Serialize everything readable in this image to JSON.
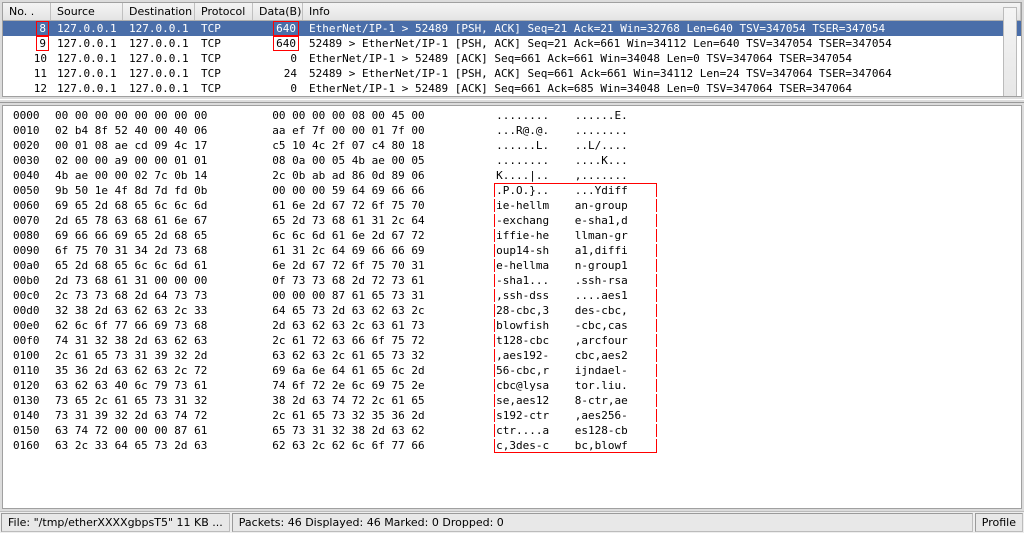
{
  "columns": {
    "no": "No. .",
    "src": "Source",
    "dst": "Destination",
    "proto": "Protocol",
    "data": "Data(B)",
    "info": "Info"
  },
  "packets": [
    {
      "no": "8",
      "no_red": true,
      "src": "127.0.0.1",
      "dst": "127.0.0.1",
      "proto": "TCP",
      "data": "640",
      "data_red": true,
      "info": "EtherNet/IP-1 > 52489 [PSH, ACK] Seq=21 Ack=21 Win=32768 Len=640 TSV=347054 TSER=347054",
      "selected": true
    },
    {
      "no": "9",
      "no_red": true,
      "src": "127.0.0.1",
      "dst": "127.0.0.1",
      "proto": "TCP",
      "data": "640",
      "data_red": true,
      "info": "52489 > EtherNet/IP-1 [PSH, ACK] Seq=21 Ack=661 Win=34112 Len=640 TSV=347054 TSER=347054"
    },
    {
      "no": "10",
      "no_red": false,
      "src": "127.0.0.1",
      "dst": "127.0.0.1",
      "proto": "TCP",
      "data": "0",
      "data_red": false,
      "info": "EtherNet/IP-1 > 52489 [ACK] Seq=661 Ack=661 Win=34048 Len=0 TSV=347064 TSER=347054"
    },
    {
      "no": "11",
      "no_red": false,
      "src": "127.0.0.1",
      "dst": "127.0.0.1",
      "proto": "TCP",
      "data": "24",
      "data_red": false,
      "info": "52489 > EtherNet/IP-1 [PSH, ACK] Seq=661 Ack=661 Win=34112 Len=24 TSV=347064 TSER=347064"
    },
    {
      "no": "12",
      "no_red": false,
      "src": "127.0.0.1",
      "dst": "127.0.0.1",
      "proto": "TCP",
      "data": "0",
      "data_red": false,
      "info": "EtherNet/IP-1 > 52489 [ACK] Seq=661 Ack=685 Win=34048 Len=0 TSV=347064 TSER=347064"
    }
  ],
  "hex": [
    {
      "off": "0000",
      "b1": "00 00 00 00 00 00 00 00",
      "b2": "00 00 00 00 08 00 45 00",
      "a1": "........",
      "a2": "......E."
    },
    {
      "off": "0010",
      "b1": "02 b4 8f 52 40 00 40 06",
      "b2": "aa ef 7f 00 00 01 7f 00",
      "a1": "...R@.@.",
      "a2": "........"
    },
    {
      "off": "0020",
      "b1": "00 01 08 ae cd 09 4c 17",
      "b2": "c5 10 4c 2f 07 c4 80 18",
      "a1": "......L.",
      "a2": "..L/...."
    },
    {
      "off": "0030",
      "b1": "02 00 00 a9 00 00 01 01",
      "b2": "08 0a 00 05 4b ae 00 05",
      "a1": "........",
      "a2": "....K..."
    },
    {
      "off": "0040",
      "b1": "4b ae 00 00 02 7c 0b 14",
      "b2": "2c 0b ab ad 86 0d 89 06",
      "a1": "K....|..",
      "a2": ",......."
    },
    {
      "off": "0050",
      "b1": "9b 50 1e 4f 8d 7d fd 0b",
      "b2": "00 00 00 59 64 69 66 66",
      "a1": ".P.O.}..",
      "a2": "...Ydiff",
      "red": "first"
    },
    {
      "off": "0060",
      "b1": "69 65 2d 68 65 6c 6c 6d",
      "b2": "61 6e 2d 67 72 6f 75 70",
      "a1": "ie-hellm",
      "a2": "an-group",
      "red": "mid"
    },
    {
      "off": "0070",
      "b1": "2d 65 78 63 68 61 6e 67",
      "b2": "65 2d 73 68 61 31 2c 64",
      "a1": "-exchang",
      "a2": "e-sha1,d",
      "red": "mid"
    },
    {
      "off": "0080",
      "b1": "69 66 66 69 65 2d 68 65",
      "b2": "6c 6c 6d 61 6e 2d 67 72",
      "a1": "iffie-he",
      "a2": "llman-gr",
      "red": "mid"
    },
    {
      "off": "0090",
      "b1": "6f 75 70 31 34 2d 73 68",
      "b2": "61 31 2c 64 69 66 66 69",
      "a1": "oup14-sh",
      "a2": "a1,diffi",
      "red": "mid"
    },
    {
      "off": "00a0",
      "b1": "65 2d 68 65 6c 6c 6d 61",
      "b2": "6e 2d 67 72 6f 75 70 31",
      "a1": "e-hellma",
      "a2": "n-group1",
      "red": "mid"
    },
    {
      "off": "00b0",
      "b1": "2d 73 68 61 31 00 00 00",
      "b2": "0f 73 73 68 2d 72 73 61",
      "a1": "-sha1...",
      "a2": ".ssh-rsa",
      "red": "mid"
    },
    {
      "off": "00c0",
      "b1": "2c 73 73 68 2d 64 73 73",
      "b2": "00 00 00 87 61 65 73 31",
      "a1": ",ssh-dss",
      "a2": "....aes1",
      "red": "mid"
    },
    {
      "off": "00d0",
      "b1": "32 38 2d 63 62 63 2c 33",
      "b2": "64 65 73 2d 63 62 63 2c",
      "a1": "28-cbc,3",
      "a2": "des-cbc,",
      "red": "mid"
    },
    {
      "off": "00e0",
      "b1": "62 6c 6f 77 66 69 73 68",
      "b2": "2d 63 62 63 2c 63 61 73",
      "a1": "blowfish",
      "a2": "-cbc,cas",
      "red": "mid"
    },
    {
      "off": "00f0",
      "b1": "74 31 32 38 2d 63 62 63",
      "b2": "2c 61 72 63 66 6f 75 72",
      "a1": "t128-cbc",
      "a2": ",arcfour",
      "red": "mid"
    },
    {
      "off": "0100",
      "b1": "2c 61 65 73 31 39 32 2d",
      "b2": "63 62 63 2c 61 65 73 32",
      "a1": ",aes192-",
      "a2": "cbc,aes2",
      "red": "mid"
    },
    {
      "off": "0110",
      "b1": "35 36 2d 63 62 63 2c 72",
      "b2": "69 6a 6e 64 61 65 6c 2d",
      "a1": "56-cbc,r",
      "a2": "ijndael-",
      "red": "mid"
    },
    {
      "off": "0120",
      "b1": "63 62 63 40 6c 79 73 61",
      "b2": "74 6f 72 2e 6c 69 75 2e",
      "a1": "cbc@lysa",
      "a2": "tor.liu.",
      "red": "mid"
    },
    {
      "off": "0130",
      "b1": "73 65 2c 61 65 73 31 32",
      "b2": "38 2d 63 74 72 2c 61 65",
      "a1": "se,aes12",
      "a2": "8-ctr,ae",
      "red": "mid"
    },
    {
      "off": "0140",
      "b1": "73 31 39 32 2d 63 74 72",
      "b2": "2c 61 65 73 32 35 36 2d",
      "a1": "s192-ctr",
      "a2": ",aes256-",
      "red": "mid"
    },
    {
      "off": "0150",
      "b1": "63 74 72 00 00 00 87 61",
      "b2": "65 73 31 32 38 2d 63 62",
      "a1": "ctr....a",
      "a2": "es128-cb",
      "red": "mid"
    },
    {
      "off": "0160",
      "b1": "63 2c 33 64 65 73 2d 63",
      "b2": "62 63 2c 62 6c 6f 77 66",
      "a1": "c,3des-c",
      "a2": "bc,blowf",
      "red": "last"
    }
  ],
  "status": {
    "file": "File: \"/tmp/etherXXXXgbpsT5\" 11 KB ...",
    "packets": "Packets: 46 Displayed: 46 Marked: 0 Dropped: 0",
    "profile": "Profile"
  }
}
